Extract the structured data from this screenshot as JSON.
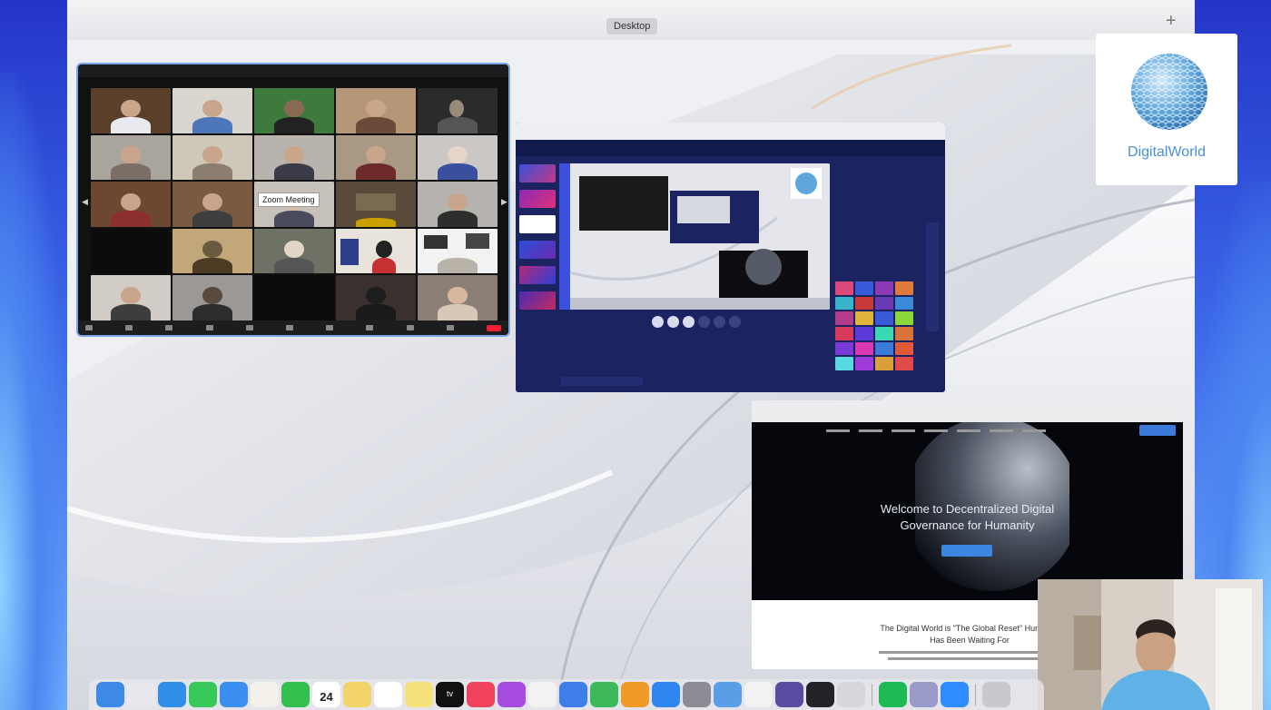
{
  "desktop": {
    "space_label": "Desktop",
    "add_space": "+"
  },
  "logo": {
    "text": "DigitalWorld",
    "icon": "globe-icon",
    "accent": "#4a8fd8"
  },
  "zoom_window": {
    "meeting_label": "Zoom Meeting",
    "accent": "#7ca7e6",
    "end_color": "#e22233"
  },
  "stream_window": {
    "accent": "#1b2460"
  },
  "website": {
    "hero_line1": "Welcome to Decentralized Digital",
    "hero_line2": "Governance for Humanity",
    "body_line1": "The Digital World is \"The Global Reset\" Humanity",
    "body_line2": "Has Been Waiting For"
  },
  "dock": {
    "calendar_day": "24",
    "tv_label": "tv",
    "apps": [
      "finder-icon",
      "launchpad-icon",
      "safari-icon",
      "messages-icon",
      "mail-icon",
      "photos-icon",
      "facetime-icon",
      "calendar-icon",
      "notes-icon",
      "reminders-icon",
      "stickies-icon",
      "appletv-icon",
      "music-icon",
      "podcasts-icon",
      "news-icon",
      "keynote-icon",
      "numbers-icon",
      "pages-icon",
      "appstore-icon",
      "settings-icon",
      "preview-icon",
      "chrome-icon",
      "obs-icon",
      "chat-icon",
      "quicktime-icon",
      "spotify-icon",
      "stack-icon",
      "zoom-icon",
      "trash-icon"
    ]
  }
}
